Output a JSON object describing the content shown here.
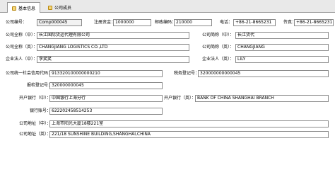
{
  "tabs": [
    {
      "label": "基本信息"
    },
    {
      "label": "公司成员"
    }
  ],
  "form": {
    "company_code_label": "公司编号：",
    "company_code": "Comp000045",
    "registered_capital_label": "注册资金：",
    "registered_capital": "1000000",
    "postal_code_label": "邮政编码：",
    "postal_code": "210000",
    "phone_label": "电话：",
    "phone": "+86-21-8665231",
    "fax_label": "传真：",
    "fax": "+86-21-8665231",
    "full_name_cn_label": "公司全称（中）：",
    "full_name_cn": "长江国际货运代理有限公司",
    "short_name_cn_label": "公司简称（中）：",
    "short_name_cn": "长江货代",
    "full_name_en_label": "公司全称（英）：",
    "full_name_en": "CHANGJIANG LOGISTICS CO.,LTD",
    "short_name_en_label": "公司简称（英）：",
    "short_name_en": "CHANGJIANG",
    "legal_rep_cn_label": "企业法人（中）：",
    "legal_rep_cn": "李笑笑",
    "legal_rep_en_label": "企业法人（英）：",
    "legal_rep_en": "LILY",
    "unified_code_label": "公司统一社会信用代码：",
    "unified_code": "913320100000000210",
    "tax_reg_label": "税务登记号：",
    "tax_reg": "320000000000045",
    "customs_reg_label": "报检登记号：",
    "customs_reg": "320000000045",
    "bank_cn_label": "开户银行（中）：",
    "bank_cn": "中国银行上海分行",
    "bank_en_label": "开户银行（英）：",
    "bank_en": "BANK OF CHINA SHANGHAI BRANCH",
    "account_label": "银行账号：",
    "account": "622202458514253",
    "address_cn_label": "公司地址（中）：",
    "address_cn": "上海市阳光大厦18楼221室",
    "address_en_label": "公司地址（英）：",
    "address_en": "221/18 SUNSHINE BUILDING,SHANGHAI,CHINA"
  },
  "colors": {
    "tabbar_bg": "#e9e9e9",
    "readonly_bg": "#f2f2f2",
    "field_border": "#8a8a8a"
  },
  "icons": [
    "folder-icon",
    "folder-icon"
  ]
}
